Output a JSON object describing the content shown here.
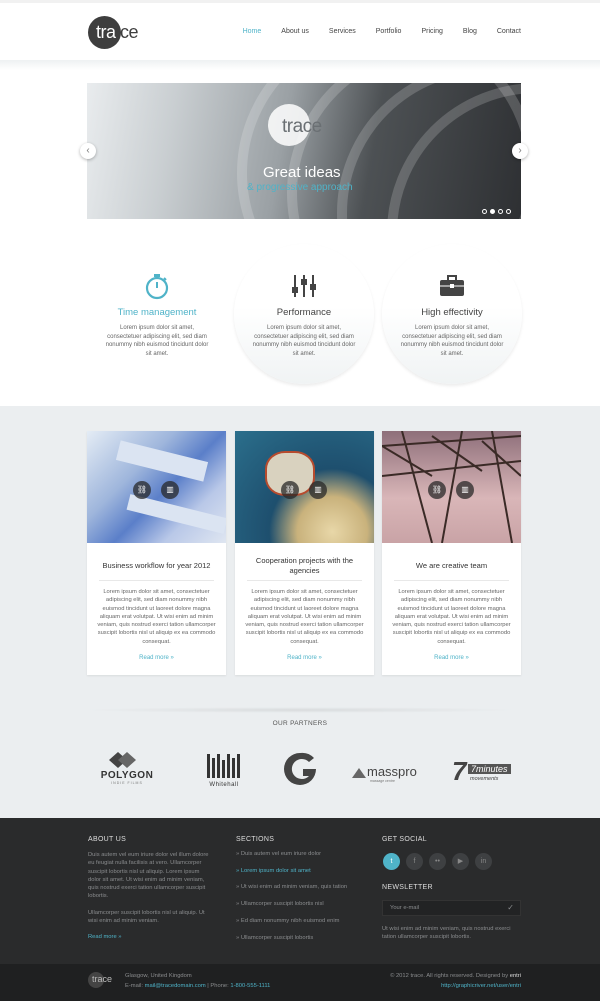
{
  "header": {
    "logo_a": "tra",
    "logo_b": "ce",
    "nav": [
      "Home",
      "About us",
      "Services",
      "Portfolio",
      "Pricing",
      "Blog",
      "Contact"
    ],
    "active": "Home"
  },
  "slider": {
    "logo": "trace",
    "title": "Great ideas",
    "subtitle": "& progressive approach",
    "prev": "‹",
    "next": "›",
    "dots": 4,
    "active_dot": 1
  },
  "features": [
    {
      "title": "Time management",
      "text": "Lorem ipsum dolor sit amet, consectetuer adipiscing elit, sed diam nonummy nibh euismod tincidunt dolor sit amet.",
      "icon": "stopwatch-icon"
    },
    {
      "title": "Performance",
      "text": "Lorem ipsum dolor sit amet, consectetuer adipiscing elit, sed diam nonummy nibh euismod tincidunt dolor sit amet.",
      "icon": "sliders-icon"
    },
    {
      "title": "High effectivity",
      "text": "Lorem ipsum dolor sit amet, consectetuer adipiscing elit, sed diam nonummy nibh euismod tincidunt dolor sit amet.",
      "icon": "briefcase-icon"
    }
  ],
  "cards": [
    {
      "title": "Business workflow for year 2012",
      "text": "Lorem ipsum dolor sit amet, consectetuer adipiscing elit, sed diam nonummy nibh euismod tincidunt ut laoreet dolore magna aliquam erat volutpat. Ut wisi enim ad minim veniam, quis nostrud exerci tation ullamcorper suscipit lobortis nisl ut aliquip ex ea commodo consequat.",
      "more": "Read more »"
    },
    {
      "title": "Cooperation projects with the agencies",
      "text": "Lorem ipsum dolor sit amet, consectetuer adipiscing elit, sed diam nonummy nibh euismod tincidunt ut laoreet dolore magna aliquam erat volutpat. Ut wisi enim ad minim veniam, quis nostrud exerci tation ullamcorper suscipit lobortis nisl ut aliquip ex ea commodo consequat.",
      "more": "Read more »"
    },
    {
      "title": "We are creative team",
      "text": "Lorem ipsum dolor sit amet, consectetuer adipiscing elit, sed diam nonummy nibh euismod tincidunt ut laoreet dolore magna aliquam erat volutpat. Ut wisi enim ad minim veniam, quis nostrud exerci tation ullamcorper suscipit lobortis nisl ut aliquip ex ea commodo consequat.",
      "more": "Read more »"
    }
  ],
  "partners": {
    "title": "OUR PARTNERS",
    "logos": [
      {
        "name": "POLYGON",
        "sub": "INDIE FILMS"
      },
      {
        "name": "Whitehall",
        "sub": ""
      },
      {
        "name": "G",
        "sub": ""
      },
      {
        "name": "masspro",
        "sub": "massage centre"
      },
      {
        "name": "7minutes",
        "sub": "movements"
      }
    ]
  },
  "footer": {
    "about_title": "ABOUT US",
    "about_text1": "Duis autem vel eum iriure dolor vel illum dolore eu feugiat nulla facilisis at vero. Ullamcorper suscipit lobortis nisl ut aliquip. Lorem ipsum dolor sit amet. Ut wisi enim ad minim veniam, quis nostrud exerci tation ullamcorper suscipit lobortis.",
    "about_text2": "Ullamcorper suscipit lobortis nisl ut aliquip. Ut wisi enim ad minim veniam.",
    "about_more": "Read more »",
    "sections_title": "SECTIONS",
    "sections": [
      "» Duis autem vel eum iriure dolor",
      "» Lorem ipsum dolor sit amet",
      "» Ut wisi enim ad minim veniam, quis tation",
      "» Ullamcorper suscipit lobortis nisl",
      "» Ed diam nonummy nibh euismod enim",
      "» Ullamcorper suscipit lobortis"
    ],
    "social_title": "GET SOCIAL",
    "social": [
      {
        "icon": "twitter-icon",
        "glyph": "t"
      },
      {
        "icon": "facebook-icon",
        "glyph": "f"
      },
      {
        "icon": "flickr-icon",
        "glyph": "••"
      },
      {
        "icon": "youtube-icon",
        "glyph": "▶"
      },
      {
        "icon": "linkedin-icon",
        "glyph": "in"
      }
    ],
    "newsletter_title": "NEWSLETTER",
    "email_placeholder": "Your e-mail",
    "newsletter_text": "Ut wisi enim ad minim veniam, quis nostrud exerci tation ullamcorper suscipit lobortis.",
    "bottom_logo": "trace",
    "address": "Glasgow, United Kingdom",
    "email_label": "E-mail:",
    "email": "mail@tracedomain.com",
    "phone_label": "| Phone:",
    "phone": "1-800-555-1111",
    "copyright_pre": "© 2012 trace. All rights reserved. Designed by",
    "designer": "entri",
    "designer_url": "http://graphicriver.net/user/entri"
  },
  "colors": {
    "accent": "#4fb3c8",
    "dark": "#2a2b2c",
    "gray": "#ebeef0"
  }
}
